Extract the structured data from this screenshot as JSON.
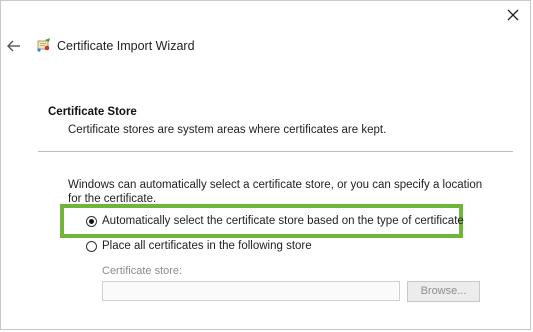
{
  "window": {
    "title": "Certificate Import Wizard",
    "close_icon": "close-icon",
    "back_icon": "back-arrow-icon",
    "wizard_icon": "certificate-wizard-icon"
  },
  "header": {
    "section_title": "Certificate Store",
    "section_description": "Certificate stores are system areas where certificates are kept."
  },
  "body": {
    "intro_text": "Windows can automatically select a certificate store, or you can specify a location for the certificate.",
    "options": [
      {
        "label": "Automatically select the certificate store based on the type of certificate",
        "checked": true
      },
      {
        "label": "Place all certificates in the following store",
        "checked": false
      }
    ],
    "store_label": "Certificate store:",
    "store_value": "",
    "browse_label": "Browse..."
  },
  "colors": {
    "highlight": "#6fb53a"
  }
}
